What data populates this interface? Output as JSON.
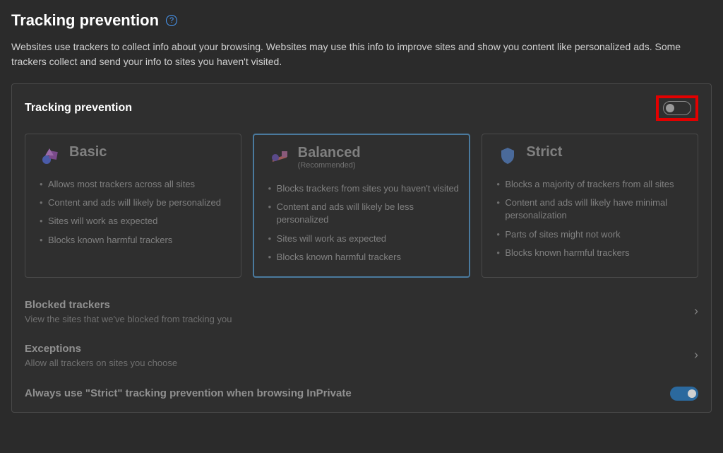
{
  "header": {
    "title": "Tracking prevention",
    "help": "?"
  },
  "description": "Websites use trackers to collect info about your browsing. Websites may use this info to improve sites and show you content like personalized ads. Some trackers collect and send your info to sites you haven't visited.",
  "panel": {
    "title": "Tracking prevention",
    "toggle": "off"
  },
  "levels": {
    "basic": {
      "title": "Basic",
      "subtitle": "",
      "features": [
        "Allows most trackers across all sites",
        "Content and ads will likely be personalized",
        "Sites will work as expected",
        "Blocks known harmful trackers"
      ]
    },
    "balanced": {
      "title": "Balanced",
      "subtitle": "(Recommended)",
      "features": [
        "Blocks trackers from sites you haven't visited",
        "Content and ads will likely be less personalized",
        "Sites will work as expected",
        "Blocks known harmful trackers"
      ]
    },
    "strict": {
      "title": "Strict",
      "subtitle": "",
      "features": [
        "Blocks a majority of trackers from all sites",
        "Content and ads will likely have minimal personalization",
        "Parts of sites might not work",
        "Blocks known harmful trackers"
      ]
    }
  },
  "sections": {
    "blocked": {
      "title": "Blocked trackers",
      "desc": "View the sites that we've blocked from tracking you"
    },
    "exceptions": {
      "title": "Exceptions",
      "desc": "Allow all trackers on sites you choose"
    }
  },
  "inprivate": {
    "label": "Always use \"Strict\" tracking prevention when browsing InPrivate"
  }
}
